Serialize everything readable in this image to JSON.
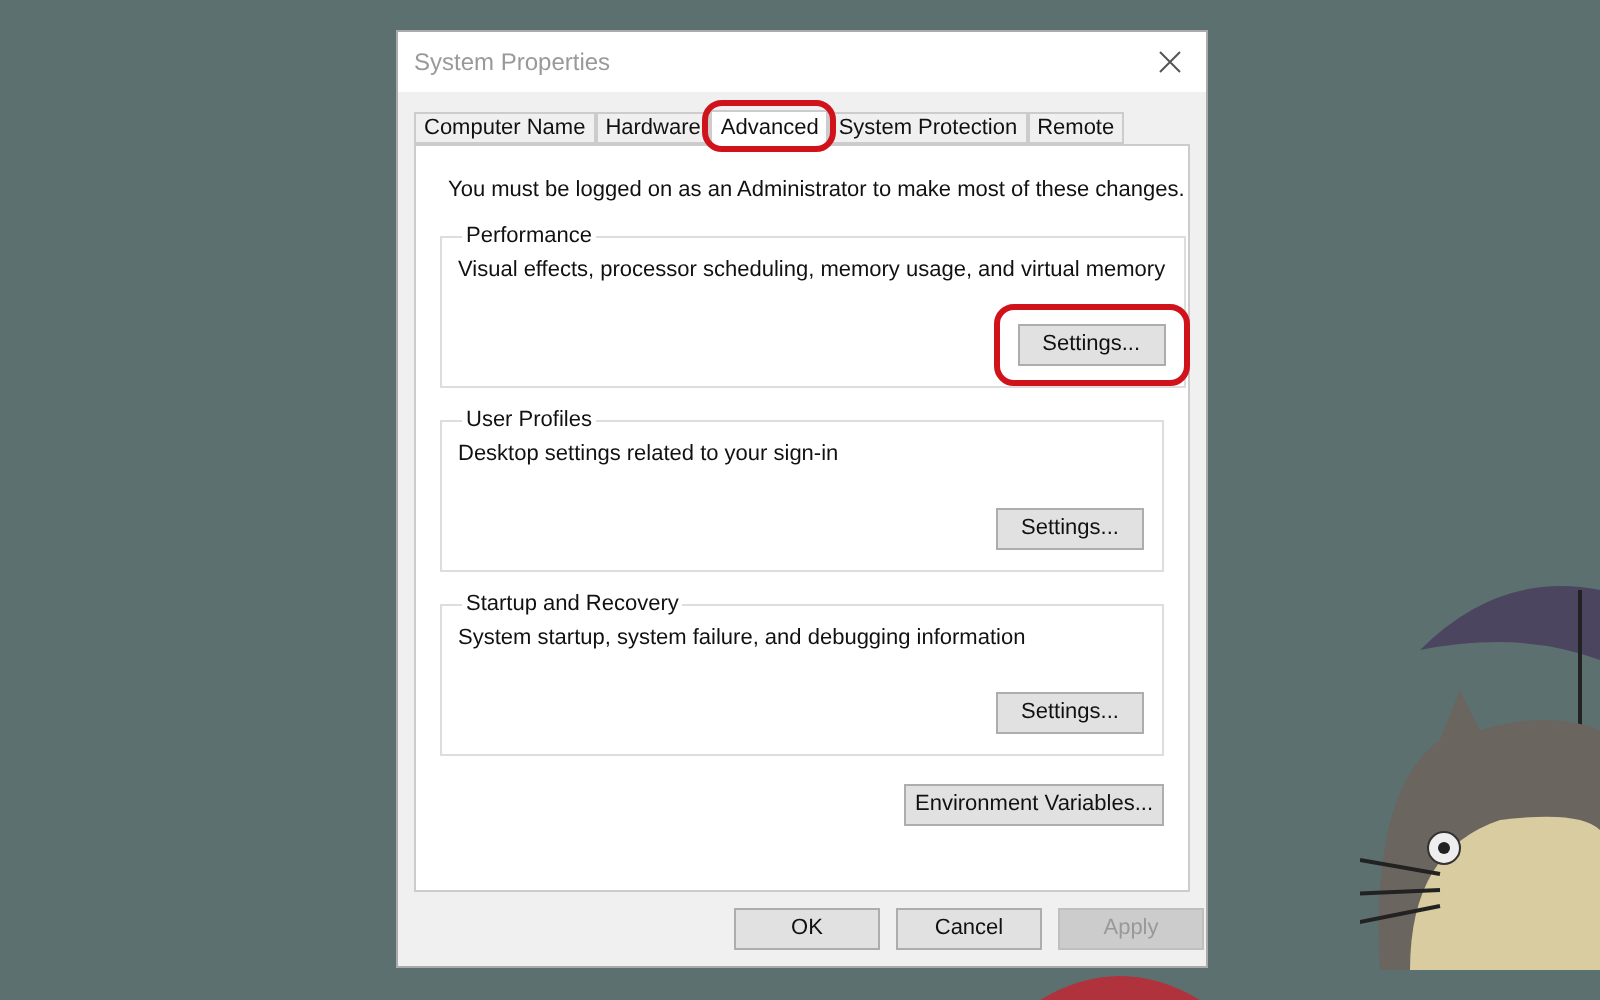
{
  "window": {
    "title": "System Properties"
  },
  "tabs": [
    {
      "label": "Computer Name",
      "selected": false,
      "circled": false
    },
    {
      "label": "Hardware",
      "selected": false,
      "circled": false
    },
    {
      "label": "Advanced",
      "selected": true,
      "circled": true
    },
    {
      "label": "System Protection",
      "selected": false,
      "circled": false
    },
    {
      "label": "Remote",
      "selected": false,
      "circled": false
    }
  ],
  "notice": "You must be logged on as an Administrator to make most of these changes.",
  "groups": [
    {
      "title": "Performance",
      "description": "Visual effects, processor scheduling, memory usage, and virtual memory",
      "button": {
        "label": "Settings...",
        "circled": true
      }
    },
    {
      "title": "User Profiles",
      "description": "Desktop settings related to your sign-in",
      "button": {
        "label": "Settings...",
        "circled": false
      }
    },
    {
      "title": "Startup and Recovery",
      "description": "System startup, system failure, and debugging information",
      "button": {
        "label": "Settings...",
        "circled": false
      }
    }
  ],
  "environment_button": "Environment Variables...",
  "footer_buttons": [
    {
      "label": "OK",
      "disabled": false
    },
    {
      "label": "Cancel",
      "disabled": false
    },
    {
      "label": "Apply",
      "disabled": true
    }
  ]
}
